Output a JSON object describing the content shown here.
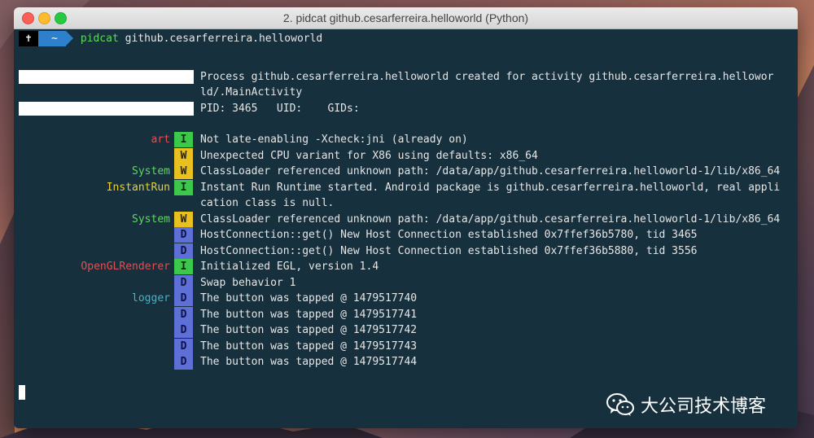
{
  "window": {
    "title": "2. pidcat github.cesarferreira.helloworld (Python)"
  },
  "prompt": {
    "segment1": "✝",
    "segment2": "~",
    "command_name": "pidcat",
    "command_args": " github.cesarferreira.helloworld"
  },
  "header": [
    "Process github.cesarferreira.helloworld created for activity github.cesarferreira.hellowor",
    "ld/.MainActivity",
    "PID: 3465   UID:    GIDs:"
  ],
  "logs": [
    {
      "tag": "art",
      "tag_color": "#e05050",
      "level": "I",
      "message": "Not late-enabling -Xcheck:jni (already on)"
    },
    {
      "tag": "",
      "tag_color": "",
      "level": "W",
      "message": "Unexpected CPU variant for X86 using defaults: x86_64"
    },
    {
      "tag": "System",
      "tag_color": "#5fd75f",
      "level": "W",
      "message": "ClassLoader referenced unknown path: /data/app/github.cesarferreira.helloworld-1/lib/x86_64"
    },
    {
      "tag": "InstantRun",
      "tag_color": "#e8d030",
      "level": "I",
      "message": "Instant Run Runtime started. Android package is github.cesarferreira.helloworld, real appli"
    },
    {
      "tag": "",
      "tag_color": "",
      "level": "",
      "message": "cation class is null."
    },
    {
      "tag": "System",
      "tag_color": "#5fd75f",
      "level": "W",
      "message": "ClassLoader referenced unknown path: /data/app/github.cesarferreira.helloworld-1/lib/x86_64"
    },
    {
      "tag": "",
      "tag_color": "",
      "level": "D",
      "message": "HostConnection::get() New Host Connection established 0x7ffef36b5780, tid 3465"
    },
    {
      "tag": "",
      "tag_color": "",
      "level": "D",
      "message": "HostConnection::get() New Host Connection established 0x7ffef36b5880, tid 3556"
    },
    {
      "tag": "OpenGLRenderer",
      "tag_color": "#e05050",
      "level": "I",
      "message": "Initialized EGL, version 1.4"
    },
    {
      "tag": "",
      "tag_color": "",
      "level": "D",
      "message": "Swap behavior 1"
    },
    {
      "tag": "logger",
      "tag_color": "#3fb8c8",
      "level": "D",
      "message": "The button was tapped @ 1479517740"
    },
    {
      "tag": "",
      "tag_color": "",
      "level": "D",
      "message": "The button was tapped @ 1479517741"
    },
    {
      "tag": "",
      "tag_color": "",
      "level": "D",
      "message": "The button was tapped @ 1479517742"
    },
    {
      "tag": "",
      "tag_color": "",
      "level": "D",
      "message": "The button was tapped @ 1479517743"
    },
    {
      "tag": "",
      "tag_color": "",
      "level": "D",
      "message": "The button was tapped @ 1479517744"
    }
  ],
  "watermark": {
    "text": "大公司技术博客",
    "icon": "wechat-icon"
  },
  "colors": {
    "terminal_bg": "#17303d",
    "level_I": "#3cc84b",
    "level_W": "#e8c020",
    "level_D": "#5e70d8"
  }
}
